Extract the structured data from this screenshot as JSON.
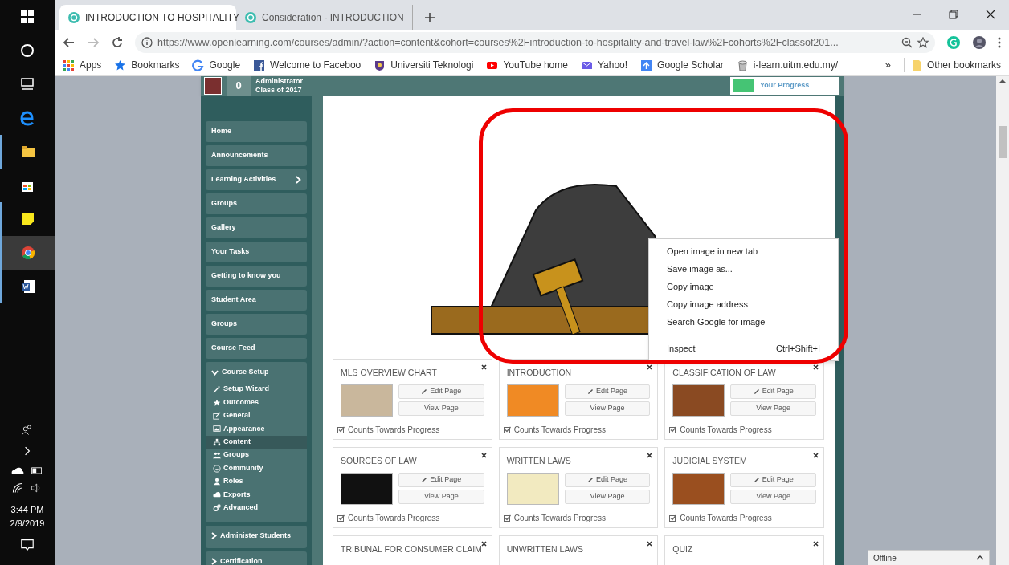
{
  "taskbar": {
    "time": "3:44 PM",
    "date": "2/9/2019"
  },
  "browser": {
    "tabs": [
      {
        "title": "INTRODUCTION TO HOSPITALITY",
        "selected": true
      },
      {
        "title": "Consideration - INTRODUCTION",
        "selected": false
      }
    ],
    "url": "https://www.openlearning.com/courses/admin/?action=content&cohort=courses%2Fintroduction-to-hospitality-and-travel-law%2Fcohorts%2Fclassof201...",
    "bookmarks": [
      "Apps",
      "Bookmarks",
      "Google",
      "Welcome to Faceboo",
      "Universiti Teknologi",
      "YouTube home",
      "Yahoo!",
      "Google Scholar",
      "i-learn.uitm.edu.my/"
    ],
    "overflow": "»",
    "other_bookmarks": "Other bookmarks"
  },
  "header": {
    "points": "0",
    "role": "Administrator",
    "cohort": "Class of 2017",
    "progress_label": "Your Progress"
  },
  "sidebar": [
    {
      "label": "Home",
      "kind": "item"
    },
    {
      "label": "Announcements",
      "kind": "item"
    },
    {
      "label": "Learning Activities",
      "kind": "submenu"
    },
    {
      "label": "Groups",
      "kind": "item"
    },
    {
      "label": "Gallery",
      "kind": "item"
    },
    {
      "label": "Your Tasks",
      "kind": "item"
    },
    {
      "label": "Getting to know you",
      "kind": "item"
    },
    {
      "label": "Student Area",
      "kind": "item"
    },
    {
      "label": "Groups",
      "kind": "item"
    },
    {
      "label": "Course Feed",
      "kind": "item"
    },
    {
      "label": "Course Setup",
      "kind": "section",
      "expanded": true,
      "children": [
        {
          "label": "Setup Wizard",
          "selected": false
        },
        {
          "label": "Outcomes",
          "selected": false
        },
        {
          "label": "General",
          "selected": false
        },
        {
          "label": "Appearance",
          "selected": false
        },
        {
          "label": "Content",
          "selected": true
        },
        {
          "label": "Groups",
          "selected": false
        },
        {
          "label": "Community",
          "selected": false
        },
        {
          "label": "Roles",
          "selected": false
        },
        {
          "label": "Exports",
          "selected": false
        },
        {
          "label": "Advanced",
          "selected": false
        }
      ]
    },
    {
      "label": "Administer Students",
      "kind": "section",
      "expanded": false
    },
    {
      "label": "Certification",
      "kind": "section",
      "expanded": false
    }
  ],
  "context_menu": [
    [
      {
        "label": "Open image in new tab"
      },
      {
        "label": "Save image as..."
      },
      {
        "label": "Copy image"
      },
      {
        "label": "Copy image address"
      },
      {
        "label": "Search Google for image"
      }
    ],
    [
      {
        "label": "Inspect",
        "shortcut": "Ctrl+Shift+I"
      }
    ]
  ],
  "cards": [
    {
      "title": "MLS OVERVIEW CHART",
      "edit": "Edit Page",
      "view": "View Page",
      "progress": "Counts Towards Progress",
      "counts": true
    },
    {
      "title": "INTRODUCTION",
      "edit": "Edit Page",
      "view": "View Page",
      "progress": "Counts Towards Progress",
      "counts": true
    },
    {
      "title": "CLASSIFICATION OF LAW",
      "edit": "Edit Page",
      "view": "View Page",
      "progress": "Counts Towards Progress",
      "counts": true
    },
    {
      "title": "SOURCES OF LAW",
      "edit": "Edit Page",
      "view": "View Page",
      "progress": "Counts Towards Progress",
      "counts": true
    },
    {
      "title": "WRITTEN LAWS",
      "edit": "Edit Page",
      "view": "View Page",
      "progress": "Counts Towards Progress",
      "counts": true
    },
    {
      "title": "JUDICIAL SYSTEM",
      "edit": "Edit Page",
      "view": "View Page",
      "progress": "Counts Towards Progress",
      "counts": true
    },
    {
      "title": "TRIBUNAL FOR CONSUMER CLAIM"
    },
    {
      "title": "UNWRITTEN LAWS"
    },
    {
      "title": "QUIZ"
    }
  ],
  "status": "Offline"
}
